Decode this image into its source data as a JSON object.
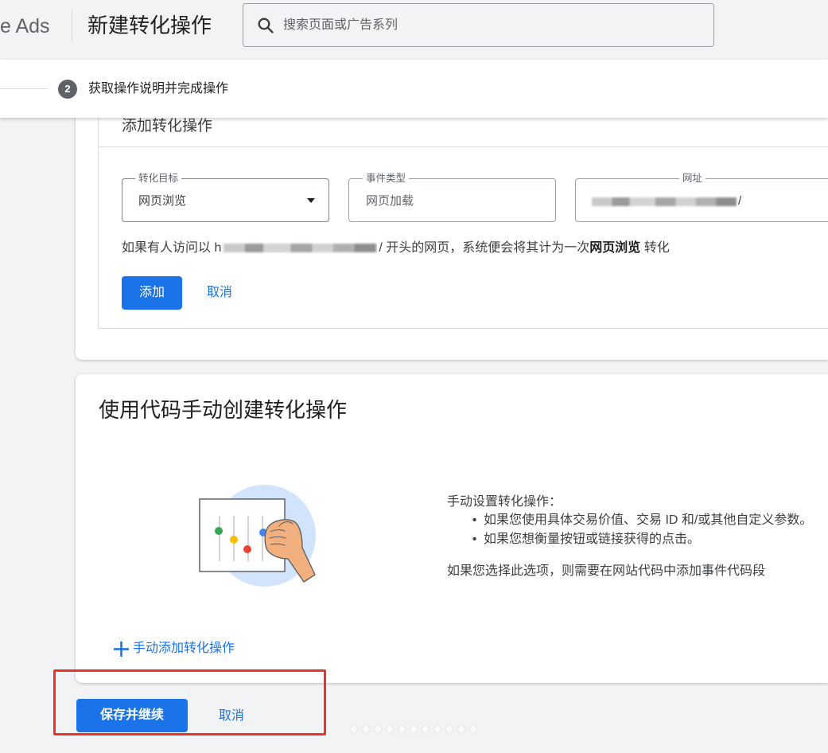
{
  "header": {
    "brand_partial": "e Ads",
    "title": "新建转化操作",
    "search_placeholder": "搜索页面或广告系列"
  },
  "stepper": {
    "step_number": "2",
    "step_label": "获取操作说明并完成操作"
  },
  "add_conversion": {
    "title": "添加转化操作",
    "goal_field": {
      "label": "转化目标",
      "value": "网页浏览"
    },
    "event_type_field": {
      "label": "事件类型",
      "value": "网页加载"
    },
    "url_field": {
      "label": "网址",
      "value_visible_suffix": "/"
    },
    "description": {
      "prefix": "如果有人访问以 h",
      "middle": "/ 开头的网页，系统便会将其计为一次",
      "bold": "网页浏览",
      "suffix": " 转化"
    },
    "add_button": "添加",
    "cancel_link": "取消"
  },
  "manual_section": {
    "title": "使用代码手动创建转化操作",
    "intro": "手动设置转化操作：",
    "bullets": [
      "如果您使用具体交易价值、交易 ID 和/或其他自定义参数。",
      "如果您想衡量按钮或链接获得的点击。"
    ],
    "note": "如果您选择此选项，则需要在网站代码中添加事件代码段",
    "add_link": "手动添加转化操作"
  },
  "footer": {
    "save_button": "保存并继续",
    "cancel_link": "取消"
  },
  "colors": {
    "accent": "#1a73e8",
    "annotation_highlight": "#e8332f",
    "page_background": "#f1f3f4",
    "illustration_circle": "#d2e3fc"
  },
  "icons": [
    "search-icon",
    "dropdown-arrow-icon",
    "plus-icon",
    "hand-slider-illustration"
  ]
}
